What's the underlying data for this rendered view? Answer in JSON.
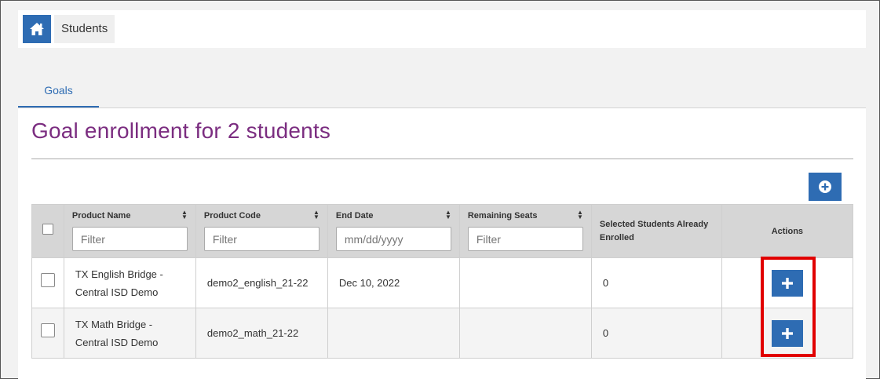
{
  "breadcrumb": {
    "home_icon": "home-icon",
    "current": "Students"
  },
  "tabs": [
    {
      "label": "Goals",
      "active": true
    }
  ],
  "page_title": "Goal enrollment for 2 students",
  "colors": {
    "accent": "#2e6cb3",
    "title": "#7b2d80",
    "highlight": "#e10000"
  },
  "table": {
    "headers": {
      "product_name": "Product Name",
      "product_code": "Product Code",
      "end_date": "End Date",
      "remaining_seats": "Remaining Seats",
      "selected_enrolled": "Selected Students Already Enrolled",
      "actions": "Actions"
    },
    "filters": {
      "product_name": "Filter",
      "product_code": "Filter",
      "end_date": "mm/dd/yyyy",
      "remaining_seats": "Filter"
    },
    "rows": [
      {
        "product_name": "TX English Bridge - Central ISD Demo",
        "product_code": "demo2_english_21-22",
        "end_date": "Dec 10, 2022",
        "remaining_seats": "",
        "enrolled": "0"
      },
      {
        "product_name": "TX Math Bridge - Central ISD Demo",
        "product_code": "demo2_math_21-22",
        "end_date": "",
        "remaining_seats": "",
        "enrolled": "0"
      }
    ]
  }
}
